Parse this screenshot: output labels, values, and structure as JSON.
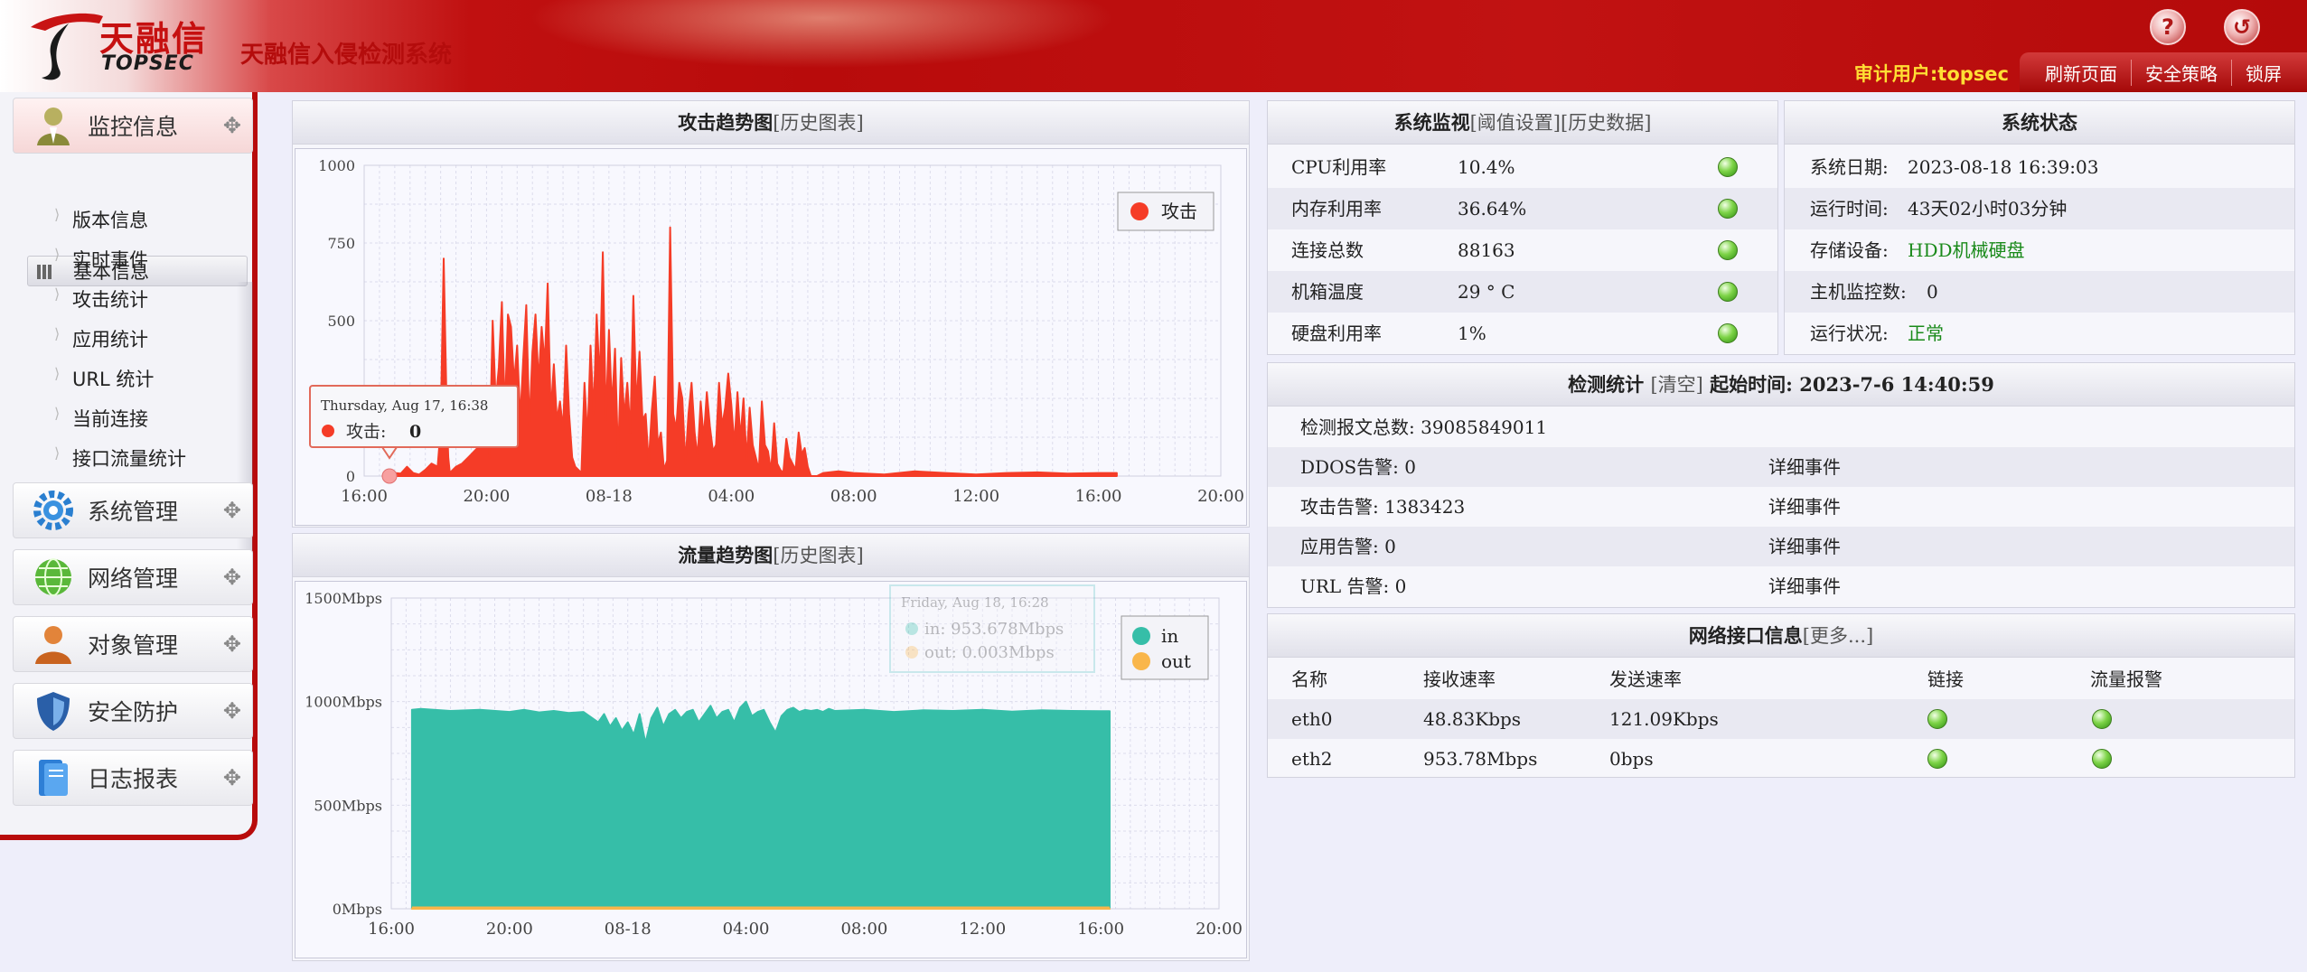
{
  "header": {
    "brand_cn": "天融信",
    "brand_en": "TOPSEC",
    "system_name": "天融信入侵检测系统",
    "help_icon": "help-icon",
    "logout_icon": "logout-icon",
    "audit_user": "审计用户:topsec",
    "menu": [
      "刷新页面",
      "安全策略",
      "锁屏"
    ]
  },
  "sidebar": {
    "groups": [
      {
        "label": "监控信息",
        "icon": "monitor-user-icon"
      },
      {
        "label": "系统管理",
        "icon": "gear-icon"
      },
      {
        "label": "网络管理",
        "icon": "globe-icon"
      },
      {
        "label": "对象管理",
        "icon": "person-object-icon"
      },
      {
        "label": "安全防护",
        "icon": "shield-icon"
      },
      {
        "label": "日志报表",
        "icon": "report-book-icon"
      }
    ],
    "monitor_items": [
      "基本信息",
      "版本信息",
      "实时事件",
      "攻击统计",
      "应用统计",
      "URL 统计",
      "当前连接",
      "接口流量统计"
    ]
  },
  "attack_chart": {
    "title": "攻击趋势图",
    "link": "[历史图表]",
    "legend": "攻击",
    "tooltip_date": "Thursday, Aug 17, 16:38",
    "tooltip_label": "攻击:",
    "tooltip_value": "0",
    "color": "#f53c27"
  },
  "traffic_chart": {
    "title": "流量趋势图",
    "link": "[历史图表]",
    "legend_in": "in",
    "legend_out": "out",
    "tooltip_date": "Friday, Aug 18, 16:28",
    "tooltip_in": "in: 953.678Mbps",
    "tooltip_out": "out: 0.003Mbps",
    "color_in": "#36bea8",
    "color_out": "#f9b64a"
  },
  "chart_data": [
    {
      "type": "area",
      "title": "攻击趋势图",
      "x_ticks": [
        "16:00",
        "20:00",
        "08-18",
        "04:00",
        "08:00",
        "12:00",
        "16:00",
        "20:00"
      ],
      "y_ticks": [
        "0",
        "250",
        "500",
        "750",
        "1000"
      ],
      "ylim": [
        0,
        1000
      ],
      "series": [
        {
          "name": "攻击",
          "x_hours": [
            0.6,
            0.8,
            1.0,
            1.2,
            1.4,
            1.6,
            1.8,
            2.0,
            2.2,
            2.4,
            2.5,
            2.6,
            2.7,
            2.75,
            2.8,
            2.9,
            3.0,
            3.2,
            3.4,
            3.6,
            3.8,
            4.0,
            4.1,
            4.2,
            4.3,
            4.4,
            4.5,
            4.6,
            4.7,
            4.8,
            4.9,
            5.0,
            5.1,
            5.2,
            5.3,
            5.4,
            5.5,
            5.6,
            5.7,
            5.8,
            5.9,
            6.0,
            6.1,
            6.2,
            6.3,
            6.4,
            6.5,
            6.6,
            6.7,
            6.8,
            6.9,
            7.0,
            7.1,
            7.2,
            7.3,
            7.4,
            7.5,
            7.6,
            7.7,
            7.8,
            7.9,
            8.0,
            8.1,
            8.2,
            8.3,
            8.4,
            8.5,
            8.6,
            8.7,
            8.8,
            8.9,
            9.0,
            9.1,
            9.2,
            9.3,
            9.4,
            9.5,
            9.6,
            9.7,
            9.8,
            9.9,
            10.0,
            10.1,
            10.2,
            10.3,
            10.4,
            10.5,
            10.6,
            10.7,
            10.8,
            10.9,
            11.0,
            11.1,
            11.2,
            11.3,
            11.4,
            11.5,
            11.6,
            11.7,
            11.8,
            11.9,
            12.0,
            12.1,
            12.2,
            12.3,
            12.4,
            12.5,
            12.6,
            12.7,
            12.8,
            12.9,
            13.0,
            13.1,
            13.2,
            13.3,
            13.4,
            13.5,
            13.6,
            13.7,
            13.8,
            13.9,
            14.0,
            14.1,
            14.2,
            14.3,
            14.4,
            14.5,
            14.6,
            14.7,
            14.8,
            15.0,
            15.5,
            16.0,
            17.0,
            18.0,
            19.0,
            20.0,
            21.0,
            22.0,
            23.0,
            24.0,
            24.6
          ],
          "values": [
            0,
            5,
            10,
            8,
            30,
            10,
            5,
            20,
            40,
            30,
            150,
            700,
            200,
            60,
            10,
            20,
            30,
            40,
            60,
            80,
            100,
            200,
            60,
            500,
            240,
            350,
            560,
            200,
            520,
            480,
            300,
            420,
            180,
            380,
            550,
            160,
            400,
            520,
            300,
            480,
            360,
            620,
            200,
            360,
            180,
            240,
            150,
            420,
            200,
            60,
            30,
            20,
            10,
            300,
            120,
            420,
            200,
            520,
            300,
            720,
            180,
            470,
            220,
            410,
            60,
            380,
            190,
            300,
            140,
            580,
            220,
            400,
            180,
            200,
            40,
            210,
            320,
            100,
            140,
            20,
            50,
            800,
            200,
            150,
            300,
            250,
            40,
            200,
            300,
            140,
            60,
            240,
            120,
            270,
            160,
            80,
            100,
            300,
            160,
            220,
            330,
            230,
            100,
            270,
            120,
            250,
            50,
            220,
            100,
            60,
            20,
            240,
            100,
            80,
            15,
            170,
            40,
            20,
            10,
            120,
            60,
            40,
            20,
            140,
            70,
            90,
            30,
            0,
            0,
            0,
            10,
            15,
            10,
            5,
            15,
            10,
            5,
            10,
            12,
            8,
            10,
            10
          ]
        }
      ]
    },
    {
      "type": "area",
      "title": "流量趋势图",
      "x_ticks": [
        "16:00",
        "20:00",
        "08-18",
        "04:00",
        "08:00",
        "12:00",
        "16:00",
        "20:00"
      ],
      "y_ticks": [
        "0Mbps",
        "500Mbps",
        "1000Mbps",
        "1500Mbps"
      ],
      "ylim": [
        0,
        1500
      ],
      "series": [
        {
          "name": "in",
          "x_hours": [
            0.7,
            1.0,
            2.0,
            3.0,
            4.0,
            4.5,
            5.0,
            5.5,
            6.0,
            6.5,
            7.0,
            7.2,
            7.4,
            7.6,
            7.8,
            8.0,
            8.2,
            8.4,
            8.6,
            8.8,
            9.0,
            9.2,
            9.4,
            9.6,
            9.8,
            10.0,
            10.2,
            10.4,
            10.6,
            10.8,
            11.0,
            11.2,
            11.4,
            11.6,
            11.8,
            12.0,
            12.2,
            12.4,
            12.6,
            12.8,
            13.0,
            13.2,
            13.4,
            13.6,
            13.8,
            14.0,
            14.2,
            14.4,
            14.6,
            14.8,
            15.0,
            16.0,
            17.0,
            18.0,
            19.0,
            20.0,
            21.0,
            22.0,
            23.0,
            24.0,
            24.3
          ],
          "values": [
            960,
            965,
            955,
            960,
            950,
            960,
            948,
            955,
            945,
            950,
            900,
            940,
            880,
            920,
            860,
            900,
            840,
            940,
            800,
            920,
            970,
            880,
            940,
            960,
            920,
            950,
            960,
            900,
            940,
            980,
            920,
            950,
            960,
            900,
            970,
            1000,
            930,
            950,
            960,
            900,
            850,
            930,
            960,
            970,
            950,
            960,
            955,
            960,
            950,
            965,
            955,
            960,
            950,
            958,
            955,
            960,
            952,
            958,
            955,
            954,
            954
          ]
        },
        {
          "name": "out",
          "x_hours": [
            0.7,
            24.3
          ],
          "values": [
            0.003,
            0.003
          ]
        }
      ]
    }
  ],
  "system_monitor": {
    "title": "系统监视",
    "link1": "[阈值设置]",
    "link2": "[历史数据]",
    "rows": [
      {
        "label": "CPU利用率",
        "value": "10.4%"
      },
      {
        "label": "内存利用率",
        "value": "36.64%"
      },
      {
        "label": "连接总数",
        "value": "88163"
      },
      {
        "label": "机箱温度",
        "value": "29 ° C"
      },
      {
        "label": "硬盘利用率",
        "value": "1%"
      }
    ]
  },
  "system_status": {
    "title": "系统状态",
    "rows": [
      {
        "label": "系统日期:",
        "value": "2023-08-18 16:39:03"
      },
      {
        "label": "运行时间:",
        "value": "43天02小时03分钟"
      },
      {
        "label": "存储设备:",
        "value": "HDD机械硬盘"
      },
      {
        "label": "主机监控数:",
        "value": "0"
      },
      {
        "label": "运行状况:",
        "value": "正常"
      }
    ]
  },
  "detect_stats": {
    "title": "检测统计",
    "clear": "[清空]",
    "start_label": "起始时间:",
    "start_time": "2023-7-6 14:40:59",
    "total": "检测报文总数: 39085849011",
    "rows": [
      {
        "label": "DDOS告警: 0",
        "link": "详细事件"
      },
      {
        "label": "攻击告警: 1383423",
        "link": "详细事件"
      },
      {
        "label": "应用告警: 0",
        "link": "详细事件"
      },
      {
        "label": "URL 告警: 0",
        "link": "详细事件"
      }
    ]
  },
  "net_interface": {
    "title": "网络接口信息",
    "more": "[更多...]",
    "headers": [
      "名称",
      "接收速率",
      "发送速率",
      "链接",
      "流量报警"
    ],
    "rows": [
      {
        "name": "eth0",
        "rx": "48.83Kbps",
        "tx": "121.09Kbps"
      },
      {
        "name": "eth2",
        "rx": "953.78Mbps",
        "tx": "0bps"
      }
    ]
  }
}
